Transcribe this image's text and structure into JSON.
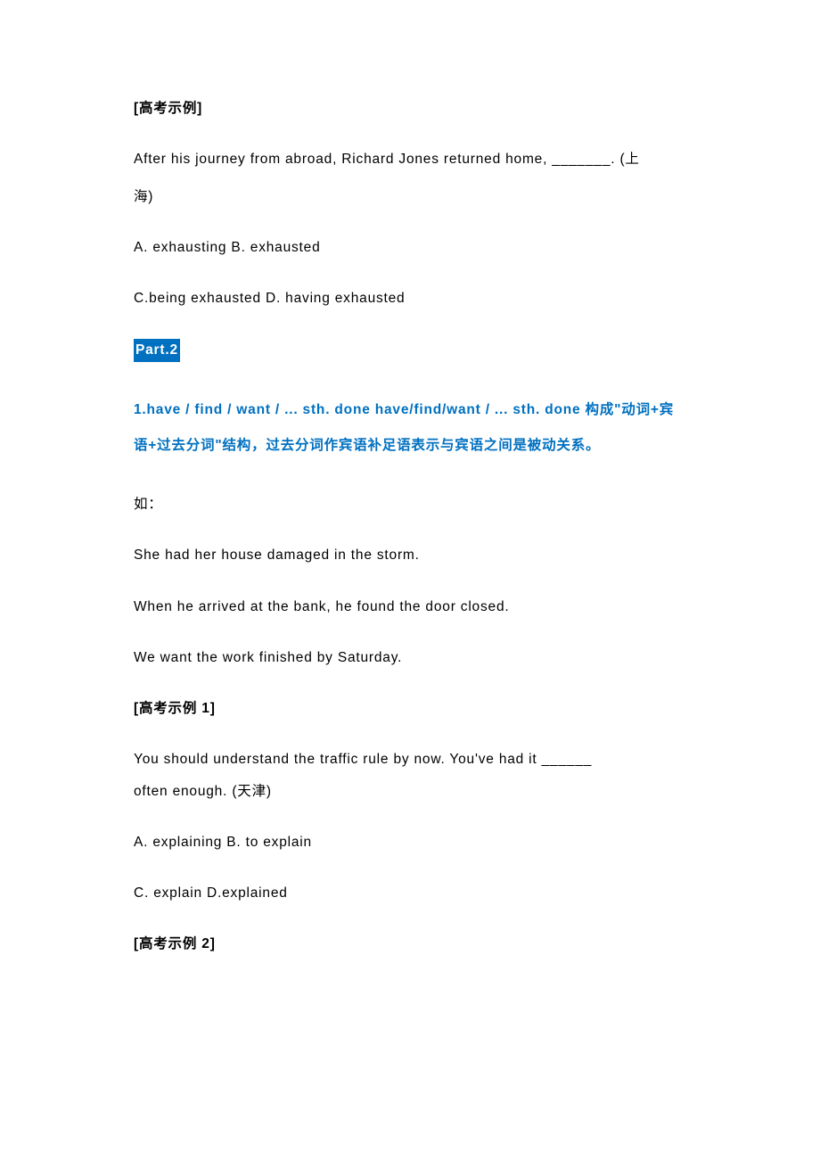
{
  "section1": {
    "heading": "[高考示例]",
    "question_line1": "After his journey from abroad, Richard Jones returned home, _______. (上",
    "question_line2": "海)",
    "options_line1": "A. exhausting        B. exhausted",
    "options_line2": "C.being exhausted       D. having exhausted"
  },
  "part2": {
    "label": "Part.2",
    "rule": "1.have / find / want / ... sth. done have/find/want / ... sth. done 构成\"动词+宾语+过去分词\"结构，过去分词作宾语补足语表示与宾语之间是被动关系。",
    "eg_label": "如：",
    "eg1": "She had her house damaged in the storm.",
    "eg2": "When he arrived at the bank, he found the door closed.",
    "eg3": "We want the work finished by Saturday."
  },
  "example1": {
    "heading": "[高考示例 1]",
    "q_line1": "You should understand the traffic rule by now. You've had it ______",
    "q_line2": "often enough.    (天津)",
    "options_line1": "A. explaining    B. to explain",
    "options_line2": "C. explain    D.explained"
  },
  "example2": {
    "heading": "[高考示例 2]"
  }
}
